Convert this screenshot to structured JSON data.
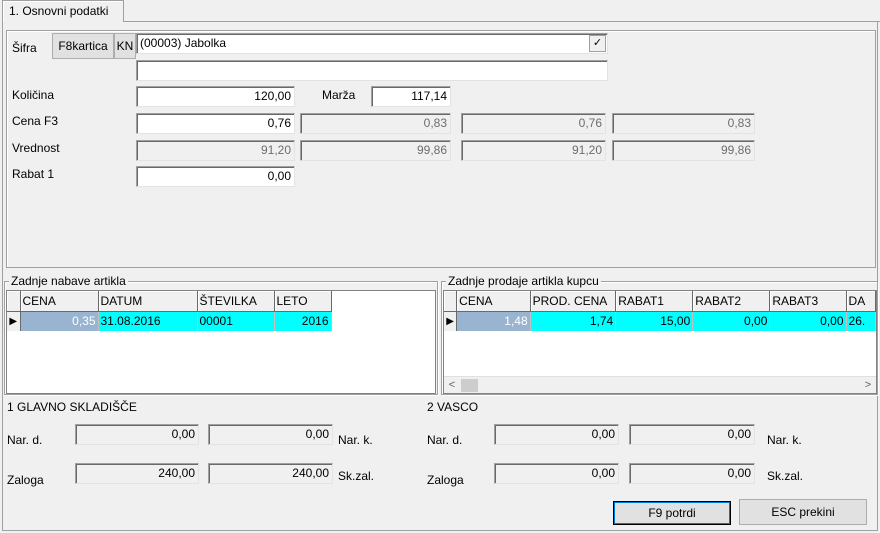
{
  "tab": {
    "label": "1. Osnovni podatki"
  },
  "header": {
    "sifra_label": "Šifra",
    "f8_button": "F8kartica",
    "kn_button": "KN",
    "article_value": "(00003) Jabolka",
    "combo_check": "✓",
    "second_line_value": ""
  },
  "form": {
    "kolicina_label": "Količina",
    "kolicina_value": "120,00",
    "marza_label": "Marža",
    "marza_value": "117,14",
    "cena_label": "Cena F3",
    "cena_values": [
      "0,76",
      "0,83",
      "0,76",
      "0,83"
    ],
    "vrednost_label": "Vrednost",
    "vrednost_values": [
      "91,20",
      "99,86",
      "91,20",
      "99,86"
    ],
    "rabat_label": "Rabat 1",
    "rabat_value": "0,00"
  },
  "nabave": {
    "title": "Zadnje nabave artikla",
    "columns": [
      "CENA",
      "DATUM",
      "ŠTEVILKA",
      "LETO"
    ],
    "rows": [
      {
        "cena": "0,35",
        "datum": "31.08.2016",
        "stevilka": "00001",
        "leto": "2016"
      }
    ]
  },
  "prodaje": {
    "title": "Zadnje prodaje artikla kupcu",
    "columns": [
      "CENA",
      "PROD. CENA",
      "RABAT1",
      "RABAT2",
      "RABAT3",
      "DA"
    ],
    "rows": [
      {
        "cena": "1,48",
        "prod_cena": "1,74",
        "rabat1": "15,00",
        "rabat2": "0,00",
        "rabat3": "0,00",
        "da": "26."
      }
    ]
  },
  "sklad1": {
    "title": "1 GLAVNO SKLADIŠČE",
    "nar_d_label": "Nar. d.",
    "nar_d_value": "0,00",
    "nar_k_value": "0,00",
    "nar_k_label": "Nar. k.",
    "zaloga_label": "Zaloga",
    "zaloga_value": "240,00",
    "sk_zal_value": "240,00",
    "sk_zal_label": "Sk.zal."
  },
  "sklad2": {
    "title": "2 VASCO",
    "nar_d_label": "Nar. d.",
    "nar_d_value": "0,00",
    "nar_k_value": "0,00",
    "nar_k_label": "Nar. k.",
    "zaloga_label": "Zaloga",
    "zaloga_value": "0,00",
    "sk_zal_value": "0,00",
    "sk_zal_label": "Sk.zal."
  },
  "buttons": {
    "confirm": "F9  potrdi",
    "cancel": "ESC  prekini"
  },
  "icons": {
    "row_indicator": "▶",
    "scroll_left": "<",
    "scroll_right": ">"
  }
}
